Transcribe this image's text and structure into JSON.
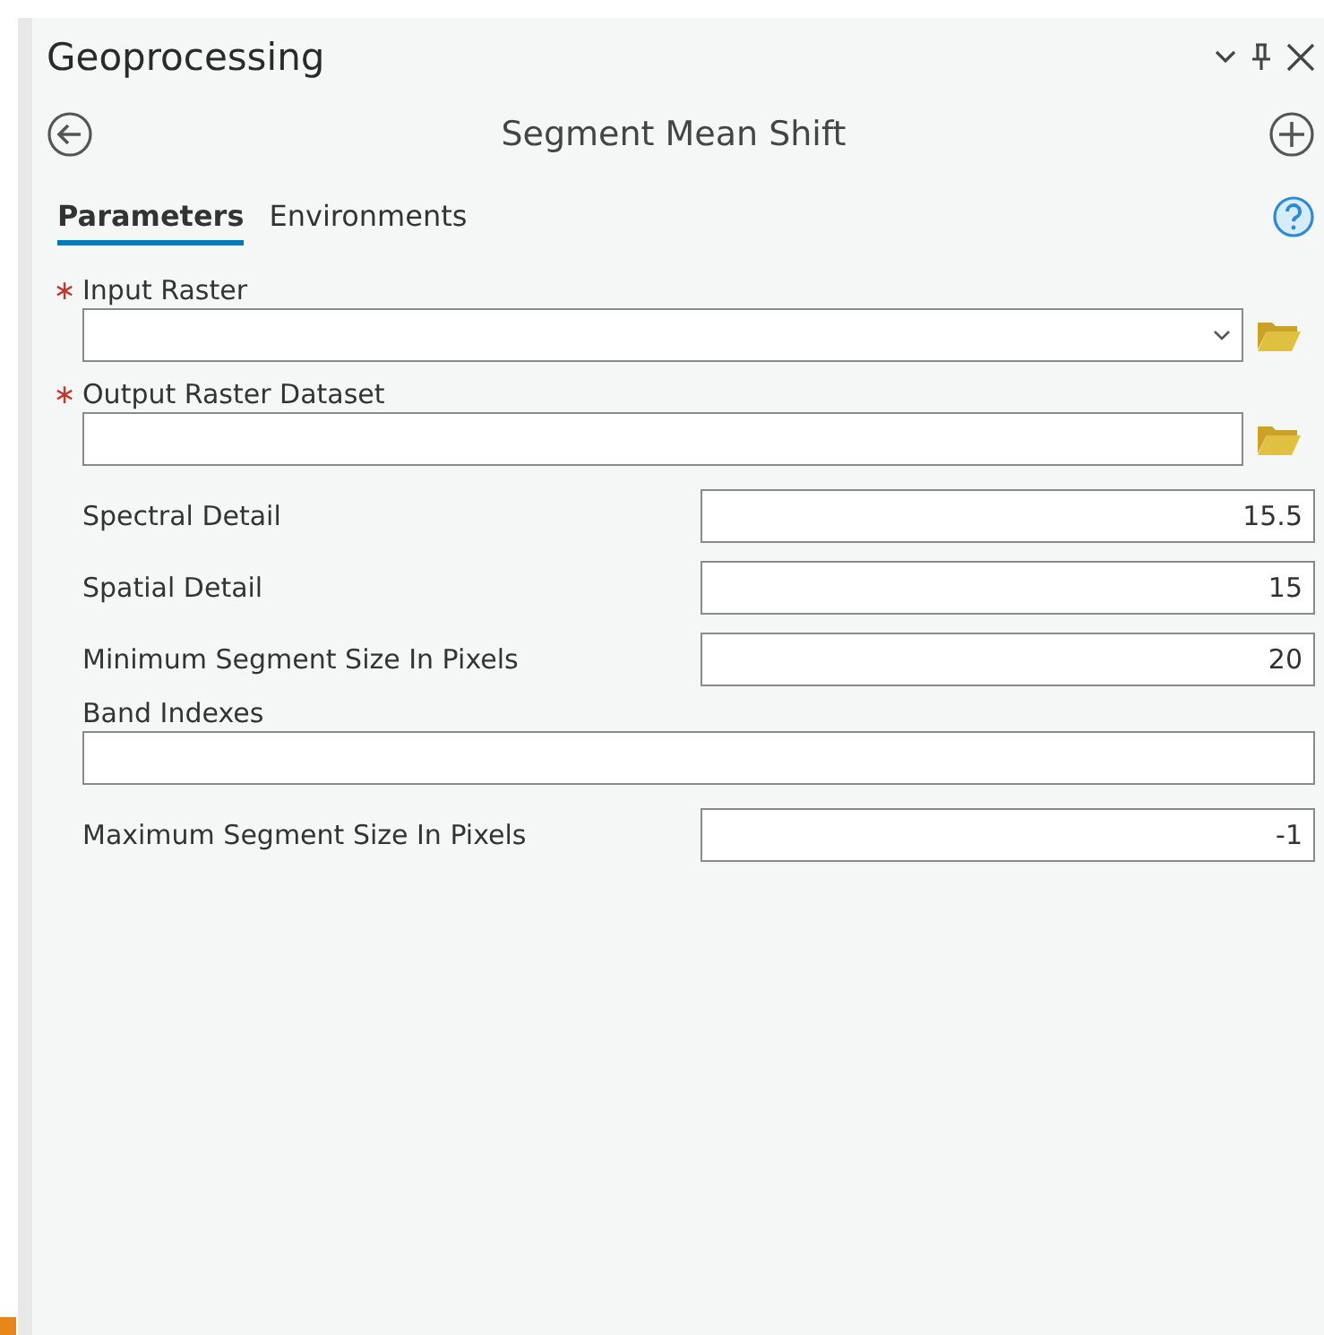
{
  "pane": {
    "title": "Geoprocessing"
  },
  "tool": {
    "title": "Segment Mean Shift"
  },
  "tabs": [
    {
      "label": "Parameters",
      "selected": true
    },
    {
      "label": "Environments",
      "selected": false
    }
  ],
  "parameters": [
    {
      "kind": "stacked",
      "label": "Input Raster",
      "required_mark": "∗",
      "dropdown": true,
      "browse": true
    },
    {
      "kind": "stacked",
      "label": "Output Raster Dataset",
      "required_mark": "∗",
      "dropdown": false,
      "browse": true
    },
    {
      "kind": "inline",
      "label": "Spectral Detail",
      "value": "15.5"
    },
    {
      "kind": "inline",
      "label": "Spatial Detail",
      "value": "15"
    },
    {
      "kind": "inline",
      "label": "Minimum Segment Size In Pixels",
      "value": "20"
    },
    {
      "kind": "stacked",
      "label": "Band Indexes",
      "dropdown": false,
      "browse": false
    },
    {
      "kind": "inline",
      "label": "Maximum Segment Size In Pixels",
      "value": "-1"
    }
  ]
}
